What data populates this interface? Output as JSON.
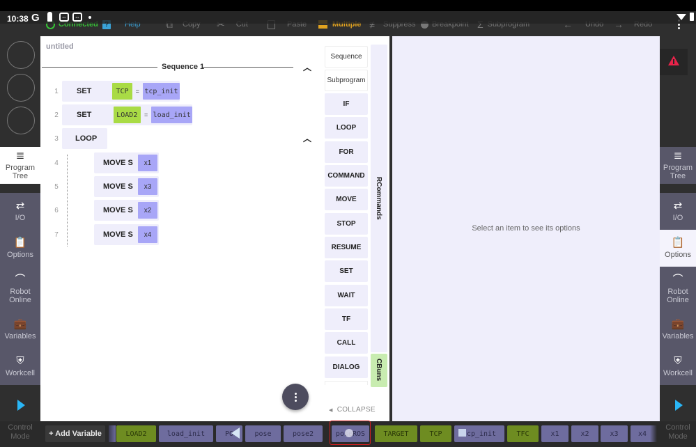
{
  "status_bar": {
    "time": "10:38",
    "g_label": "G"
  },
  "toolbar": {
    "connection": "Connected",
    "help": "Help",
    "help_icon": "?",
    "copy": "Copy",
    "cut": "Cut",
    "paste": "Paste",
    "multiple": "Multiple",
    "suppress": "Suppress",
    "breakpoint": "Breakpoint",
    "subprogram": "Subprogram",
    "undo": "Undo",
    "redo": "Redo",
    "icons": {
      "copy": "⧉",
      "cut": "✂",
      "paste": "📋",
      "suppress": "≢",
      "subprogram": "Σ",
      "undo": "←",
      "redo": "→"
    },
    "colors": {
      "connected": "#36c236",
      "help": "#3aa3d8",
      "multiple": "#e2a31f"
    }
  },
  "left_nav": {
    "items": [
      {
        "label": "Program\nTree",
        "icon": "≣",
        "active": true
      },
      {
        "label": "I/O",
        "icon": "⇄",
        "active": false
      },
      {
        "label": "Options",
        "icon": "📋",
        "active": false
      },
      {
        "label": "Robot\nOnline",
        "icon": "⌒",
        "active": false
      },
      {
        "label": "Variables",
        "icon": "💼",
        "active": false
      },
      {
        "label": "Workcell",
        "icon": "⛨",
        "active": false
      }
    ],
    "control_mode": "Control\nMode"
  },
  "right_nav": {
    "items": [
      {
        "label": "Program\nTree",
        "icon": "≣",
        "active": false
      },
      {
        "label": "I/O",
        "icon": "⇄",
        "active": false
      },
      {
        "label": "Options",
        "icon": "📋",
        "active": true
      },
      {
        "label": "Robot\nOnline",
        "icon": "⌒",
        "active": false
      },
      {
        "label": "Variables",
        "icon": "💼",
        "active": false
      },
      {
        "label": "Workcell",
        "icon": "⛨",
        "active": false
      }
    ],
    "control_mode": "Control\nMode",
    "warning_color": "#e8234a"
  },
  "program": {
    "title": "untitled",
    "sequence_title": "Sequence 1",
    "rows": [
      {
        "num": "1",
        "keyword": "SET",
        "target": "TCP",
        "eq": "=",
        "value": "tcp_init"
      },
      {
        "num": "2",
        "keyword": "SET",
        "target": "LOAD2",
        "eq": "=",
        "value": "load_init"
      },
      {
        "num": "3",
        "keyword": "LOOP"
      },
      {
        "num": "4",
        "keyword": "MOVE S",
        "value": "x1"
      },
      {
        "num": "5",
        "keyword": "MOVE S",
        "value": "x3"
      },
      {
        "num": "6",
        "keyword": "MOVE S",
        "value": "x2"
      },
      {
        "num": "7",
        "keyword": "MOVE S",
        "value": "x4"
      }
    ]
  },
  "commands": {
    "buttons": [
      "Sequence",
      "Subprogram",
      "IF",
      "LOOP",
      "FOR",
      "COMMAND",
      "MOVE",
      "STOP",
      "RESUME",
      "SET",
      "WAIT",
      "TF",
      "CALL",
      "DIALOG"
    ],
    "tab_rcommands": "RCommands",
    "tab_cbuns": "CBuns",
    "collapse": "COLLAPSE"
  },
  "options_panel": {
    "message": "Select an item to see its options"
  },
  "variable_bar": {
    "add_button": "+ Add Variable",
    "variables": [
      {
        "name": "LOAD2",
        "type": "green"
      },
      {
        "name": "load_init",
        "type": "purple"
      },
      {
        "name": "PO",
        "type": "purple"
      },
      {
        "name": "pose",
        "type": "purple"
      },
      {
        "name": "pose2",
        "type": "purple"
      },
      {
        "name": "poseROS",
        "type": "purple"
      },
      {
        "name": "TARGET",
        "type": "green"
      },
      {
        "name": "TCP",
        "type": "green"
      },
      {
        "name": "tcp_init",
        "type": "purple"
      },
      {
        "name": "TFC",
        "type": "green"
      },
      {
        "name": "x1",
        "type": "purple"
      },
      {
        "name": "x2",
        "type": "purple"
      },
      {
        "name": "x3",
        "type": "purple"
      },
      {
        "name": "x4",
        "type": "purple"
      }
    ]
  }
}
